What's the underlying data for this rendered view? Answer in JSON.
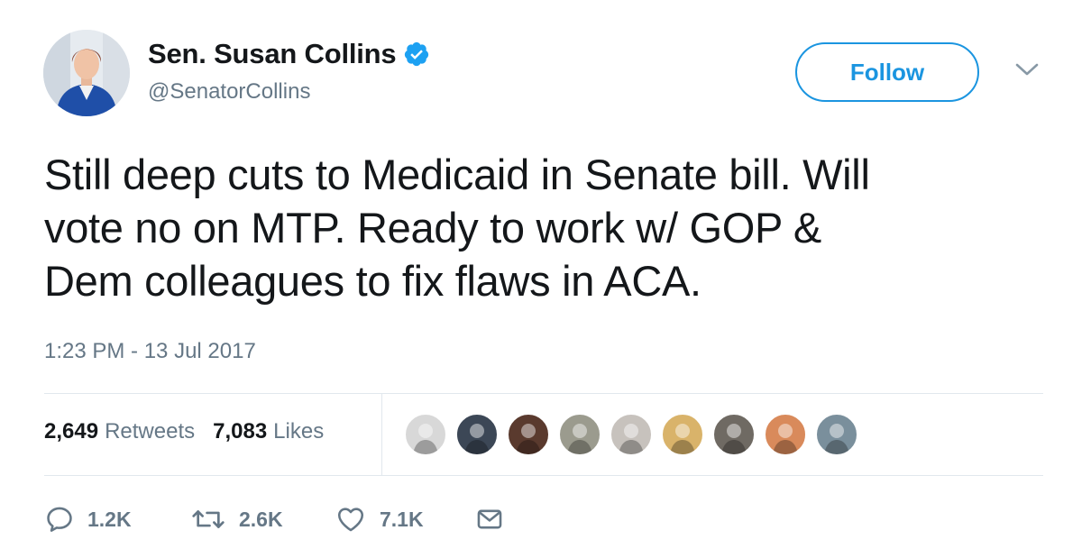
{
  "author": {
    "display_name": "Sen. Susan Collins",
    "handle": "@SenatorCollins",
    "verified": true
  },
  "follow_button": {
    "label": "Follow"
  },
  "tweet": {
    "text_lines": [
      "Still deep cuts to Medicaid in Senate bill. Will",
      "vote no on MTP. Ready to work w/ GOP &",
      "Dem colleagues to fix flaws in ACA."
    ],
    "timestamp": "1:23 PM - 13 Jul 2017"
  },
  "stats": {
    "retweets": {
      "count": "2,649",
      "label": "Retweets"
    },
    "likes": {
      "count": "7,083",
      "label": "Likes"
    }
  },
  "liked_by_avatars": [
    {
      "icon": "man-avatar",
      "color": "#d8d8d8"
    },
    {
      "icon": "silhouette-avatar",
      "color": "#3c4756"
    },
    {
      "icon": "woman-avatar",
      "color": "#5a3a2e"
    },
    {
      "icon": "man-avatar",
      "color": "#9b9b8e"
    },
    {
      "icon": "cat-avatar",
      "color": "#c7c2bd"
    },
    {
      "icon": "woman-avatar",
      "color": "#d9b36a"
    },
    {
      "icon": "cat-avatar",
      "color": "#6f6a63"
    },
    {
      "icon": "woman-avatar",
      "color": "#d98a5b"
    },
    {
      "icon": "bird-avatar",
      "color": "#7a8f9c"
    }
  ],
  "actions": {
    "reply": {
      "icon": "reply-icon",
      "count": "1.2K"
    },
    "retweet": {
      "icon": "retweet-icon",
      "count": "2.6K"
    },
    "like": {
      "icon": "heart-icon",
      "count": "7.1K"
    },
    "dm": {
      "icon": "envelope-icon"
    }
  },
  "colors": {
    "accent": "#1b95e0",
    "text": "#14171a",
    "secondary_text": "#657786",
    "divider": "#e1e8ed"
  }
}
